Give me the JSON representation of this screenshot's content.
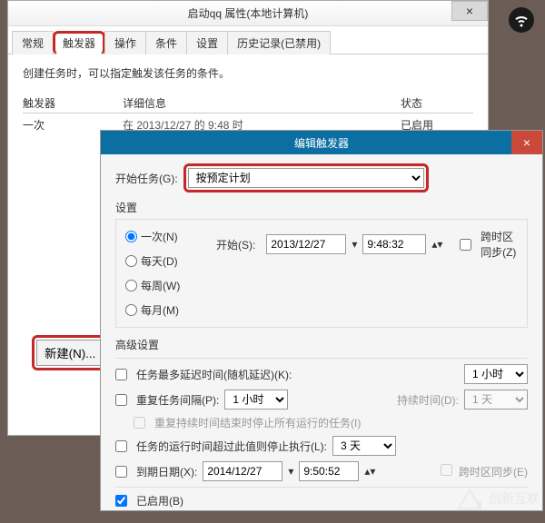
{
  "wifi_icon": "wifi",
  "window1": {
    "title": "启动qq 属性(本地计算机)",
    "close": "×",
    "tabs": [
      "常规",
      "触发器",
      "操作",
      "条件",
      "设置",
      "历史记录(已禁用)"
    ],
    "active_tab_index": 1,
    "desc": "创建任务时，可以指定触发该任务的条件。",
    "columns": {
      "trigger": "触发器",
      "detail": "详细信息",
      "status": "状态"
    },
    "rows": [
      {
        "trigger": "一次",
        "detail": "在 2013/12/27 的 9:48 时",
        "status": "已启用"
      }
    ],
    "new_button": "新建(N)..."
  },
  "window2": {
    "title": "编辑触发器",
    "close": "×",
    "start_task_label": "开始任务(G):",
    "start_task_value": "按预定计划",
    "settings_label": "设置",
    "radios": {
      "once": "一次(N)",
      "daily": "每天(D)",
      "weekly": "每周(W)",
      "monthly": "每月(M)"
    },
    "selected_radio": "once",
    "start_label": "开始(S):",
    "start_date": "2013/12/27",
    "start_time": "9:48:32",
    "sync_tz": "跨时区同步(Z)",
    "advanced_label": "高级设置",
    "adv": {
      "delay_label": "任务最多延迟时间(随机延迟)(K):",
      "delay_value": "1 小时",
      "repeat_label": "重复任务间隔(P):",
      "repeat_value": "1 小时",
      "duration_label": "持续时间(D):",
      "duration_value": "1 天",
      "stop_after_rep": "重复持续时间结束时停止所有运行的任务(I)",
      "stop_if_longer_label": "任务的运行时间超过此值则停止执行(L):",
      "stop_if_longer_value": "3 天",
      "expire_label": "到期日期(X):",
      "expire_date": "2014/12/27",
      "expire_time": "9:50:52",
      "expire_sync": "跨时区同步(E)",
      "enabled_label": "已启用(B)"
    }
  },
  "watermark": "创新互联"
}
